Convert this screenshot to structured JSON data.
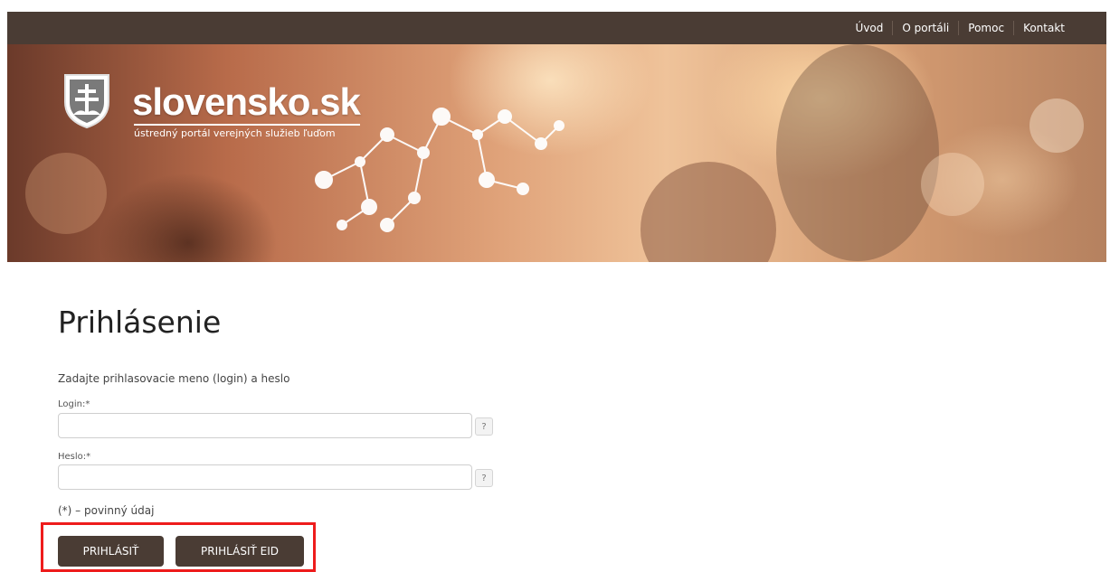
{
  "nav": {
    "items": [
      "Úvod",
      "O portáli",
      "Pomoc",
      "Kontakt"
    ]
  },
  "brand": {
    "title": "slovensko.sk",
    "subtitle": "ústredný portál verejných služieb ľuďom"
  },
  "page": {
    "title": "Prihlásenie",
    "instruction": "Zadajte prihlasovacie meno (login) a heslo",
    "required_note": "(*) – povinný údaj"
  },
  "form": {
    "login_label": "Login:*",
    "login_value": "",
    "password_label": "Heslo:*",
    "password_value": "",
    "help_glyph": "?"
  },
  "buttons": {
    "login": "PRIHLÁSIŤ",
    "login_eid": "PRIHLÁSIŤ EID"
  },
  "colors": {
    "header_bg": "#4a3c34",
    "button_bg": "#4a3c34",
    "highlight": "#ee1c1c"
  }
}
